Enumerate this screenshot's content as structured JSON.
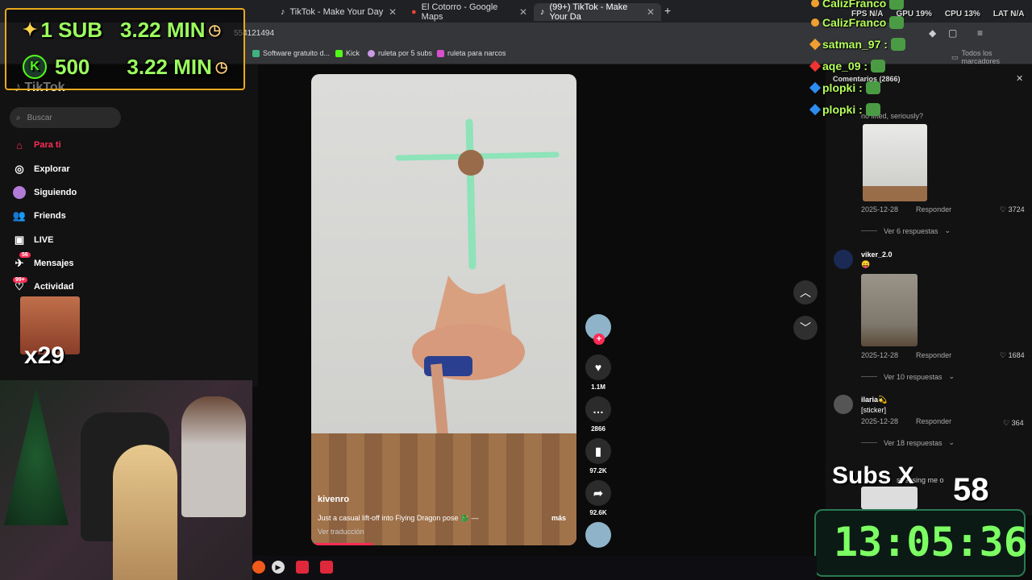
{
  "browser": {
    "tabs": [
      {
        "label": "TikTok - Make Your Day",
        "icon": "tiktok-icon"
      },
      {
        "label": "El Cotorro - Google Maps",
        "icon": "maps-icon"
      },
      {
        "label": "(99+) TikTok - Make Your Da",
        "icon": "tiktok-icon",
        "active": true
      }
    ],
    "url_fragment": "554121494",
    "bookmarks": [
      "Software gratuito d...",
      "Kick",
      "ruleta por 5 subs",
      "ruleta para narcos",
      "Todos los marcadores"
    ]
  },
  "sidebar": {
    "search_placeholder": "Buscar",
    "items": [
      {
        "label": "Para ti",
        "icon": "home-icon",
        "active": true
      },
      {
        "label": "Explorar",
        "icon": "compass-icon"
      },
      {
        "label": "Siguiendo",
        "icon": "following-icon"
      },
      {
        "label": "Friends",
        "icon": "friends-icon"
      },
      {
        "label": "LIVE",
        "icon": "live-icon"
      },
      {
        "label": "Mensajes",
        "icon": "messages-icon",
        "badge": "56"
      },
      {
        "label": "Actividad",
        "icon": "activity-icon",
        "badge": "99+"
      }
    ]
  },
  "video": {
    "author": "kivenro",
    "caption": "Just a casual lift-off into Flying Dragon pose 🐉 —",
    "more": "más",
    "translate": "Ver traducción",
    "progress": 0.23
  },
  "actions": {
    "likes": "1.1M",
    "comments": "2866",
    "saves": "97.2K",
    "shares": "92.6K"
  },
  "comments_panel": {
    "title": "Comentarios (2866)",
    "partial_text": "no lifted, seriously?",
    "items": [
      {
        "date": "2025-12-28",
        "reply": "Responder",
        "likes": "3724",
        "more": "Ver 6 respuestas"
      },
      {
        "user": "viker_2.0",
        "text": "😛",
        "date": "2025-12-28",
        "reply": "Responder",
        "likes": "1684",
        "more": "Ver 10 respuestas"
      },
      {
        "user": "ilaria💫",
        "text": "[sticker]",
        "date": "2025-12-28",
        "reply": "Responder",
        "likes": "364",
        "more": "Ver 18 respuestas"
      }
    ],
    "last_partial": "stressing me o"
  },
  "overlay": {
    "goal1": {
      "count": "1 SUB",
      "time": "3.22 MIN"
    },
    "goal2": {
      "count": "500",
      "time": "3.22 MIN"
    },
    "multiplier": "x29",
    "stats": {
      "fps": "FPS N/A",
      "gpu": "GPU 19%",
      "cpu": "CPU 13%",
      "lat": "LAT N/A"
    },
    "chat": [
      {
        "user": "CalizFranco"
      },
      {
        "user": "CalizFranco"
      },
      {
        "user": "satman_97 :"
      },
      {
        "user": "aqe_09 :"
      },
      {
        "user": "plopki :"
      },
      {
        "user": "plopki :"
      }
    ],
    "subs_label": "Subs X",
    "subs_value": "58",
    "timer": "13:05:36"
  }
}
